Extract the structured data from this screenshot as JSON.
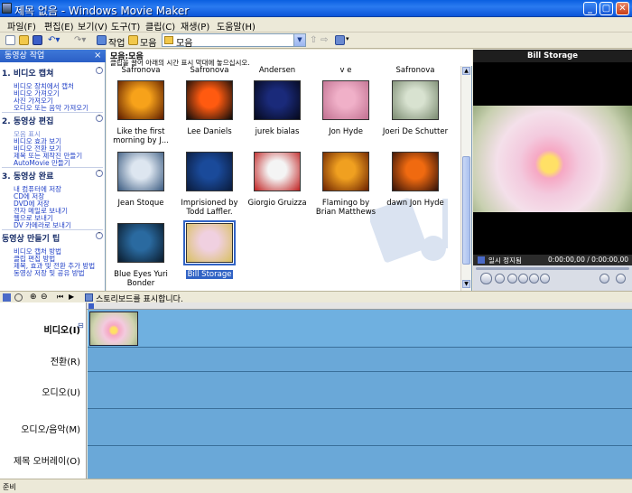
{
  "window": {
    "title": "제목 없음 - Windows Movie Maker"
  },
  "menu": [
    "파일(F)",
    "편집(E)",
    "보기(V)",
    "도구(T)",
    "클립(C)",
    "재생(P)",
    "도움말(H)"
  ],
  "toolbar": {
    "tasks_label": "작업",
    "collections_label": "모음",
    "collection_value": "모음"
  },
  "tasks": {
    "header": "동영상 작업",
    "close": "×",
    "sections": [
      {
        "title": "1. 비디오 캡쳐",
        "links": [
          "비디오 장치에서 캡처",
          "비디오 가져오기",
          "사진 가져오기",
          "오디오 또는 음악 가져오기"
        ]
      },
      {
        "title": "2. 동영상 편집",
        "links": [
          "모음 표시",
          "비디오 효과 보기",
          "비디오 전환 보기",
          "제목 또는 제작진 만들기",
          "AutoMovie 만들기"
        ]
      },
      {
        "title": "3. 동영상 완료",
        "links": [
          "내 컴퓨터에 저장",
          "CD에 저장",
          "DVD에 저장",
          "전자 메일로 보내기",
          "웹으로 보내기",
          "DV 카메라로 보내기"
        ]
      },
      {
        "title": "동영상 만들기 팁",
        "links": [
          "비디오 캡처 방법",
          "클립 편집 방법",
          "제목, 효과 및 전환 추가 방법",
          "동영상 저장 및 공유 방법"
        ]
      }
    ]
  },
  "collection": {
    "path": "모음:모음",
    "hint": "클립을 끌어 아래의 시간 표시 막대에 놓으십시오.",
    "top_captions": [
      "Safronova",
      "Andersen",
      "v e",
      "Safronova"
    ],
    "items": [
      {
        "caption": "Like the first morning by J...",
        "colors": [
          "#f7a21a",
          "#5a1a00"
        ]
      },
      {
        "caption": "Lee Daniels",
        "colors": [
          "#ff5a10",
          "#0a0a0a"
        ]
      },
      {
        "caption": "jurek bialas",
        "colors": [
          "#1a2a7a",
          "#05081a"
        ]
      },
      {
        "caption": "Jon Hyde",
        "colors": [
          "#f0b0c8",
          "#c07090"
        ]
      },
      {
        "caption": "Joeri De Schutter",
        "colors": [
          "#d8e2d0",
          "#7a8a70"
        ]
      },
      {
        "caption": "Jean Stoque",
        "colors": [
          "#dde6f0",
          "#3a5a80"
        ]
      },
      {
        "caption": "Imprisioned by Todd Laffler.",
        "colors": [
          "#1a4a9a",
          "#0a1a3a"
        ]
      },
      {
        "caption": "Giorgio Gruizza",
        "colors": [
          "#f4f4f4",
          "#c02020"
        ]
      },
      {
        "caption": "Flamingo by Brian Matthews",
        "colors": [
          "#f0a020",
          "#6a2000"
        ]
      },
      {
        "caption": "dawn Jon Hyde",
        "colors": [
          "#f06a10",
          "#301008"
        ]
      },
      {
        "caption": "Blue Eyes Yuri Bonder",
        "colors": [
          "#2a6aa0",
          "#0a1a2a"
        ]
      },
      {
        "caption": "Bill Storage",
        "colors": [
          "#f0d0e0",
          "#d8c060"
        ],
        "selected": true
      }
    ]
  },
  "monitor": {
    "title": "Bill Storage",
    "status": "일시 정지됨",
    "time": "0:00:00,00 / 0:00:00,00"
  },
  "storyboard": {
    "message": "스토리보드를 표시합니다."
  },
  "timeline": {
    "tracks": [
      "비디오(I)",
      "전환(R)",
      "오디오(U)",
      "오디오/음악(M)",
      "제목 오버레이(O)"
    ],
    "collapse": "⊟"
  },
  "statusbar": {
    "text": "준비"
  }
}
